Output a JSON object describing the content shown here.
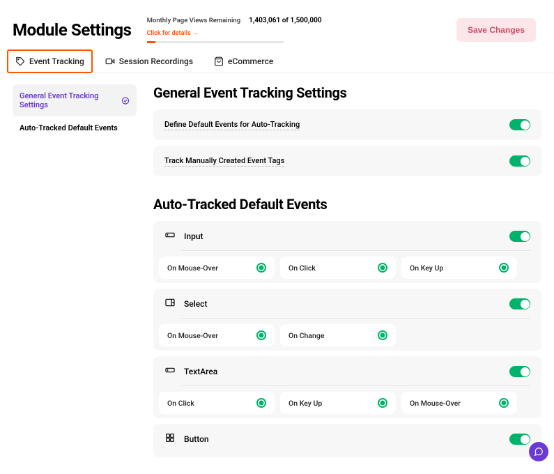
{
  "page_title": "Module Settings",
  "usage": {
    "label": "Monthly Page Views Remaining",
    "link_text": "Click for details →",
    "current": "1,403,061",
    "sep": "of",
    "total": "1,500,000",
    "pct_used": 6.5
  },
  "save_button": "Save Changes",
  "tabs": [
    {
      "id": "event-tracking",
      "label": "Event Tracking",
      "active": true
    },
    {
      "id": "session-recordings",
      "label": "Session Recordings",
      "active": false
    },
    {
      "id": "ecommerce",
      "label": "eCommerce",
      "active": false
    }
  ],
  "sidenav": [
    {
      "id": "general",
      "label": "General Event Tracking Settings",
      "active": true,
      "checked": true
    },
    {
      "id": "auto",
      "label": "Auto-Tracked Default Events",
      "active": false
    }
  ],
  "sections": {
    "general": {
      "title": "General Event Tracking Settings",
      "items": [
        {
          "label": "Define Default Events for Auto-Tracking"
        },
        {
          "label": "Track Manually Created Event Tags"
        }
      ]
    },
    "auto": {
      "title": "Auto-Tracked Default Events",
      "groups": [
        {
          "name": "Input",
          "triggers": [
            "On Mouse-Over",
            "On Click",
            "On Key Up"
          ]
        },
        {
          "name": "Select",
          "triggers": [
            "On Mouse-Over",
            "On Change"
          ]
        },
        {
          "name": "TextArea",
          "triggers": [
            "On Click",
            "On Key Up",
            "On Mouse-Over"
          ]
        },
        {
          "name": "Button",
          "triggers": []
        }
      ]
    }
  }
}
